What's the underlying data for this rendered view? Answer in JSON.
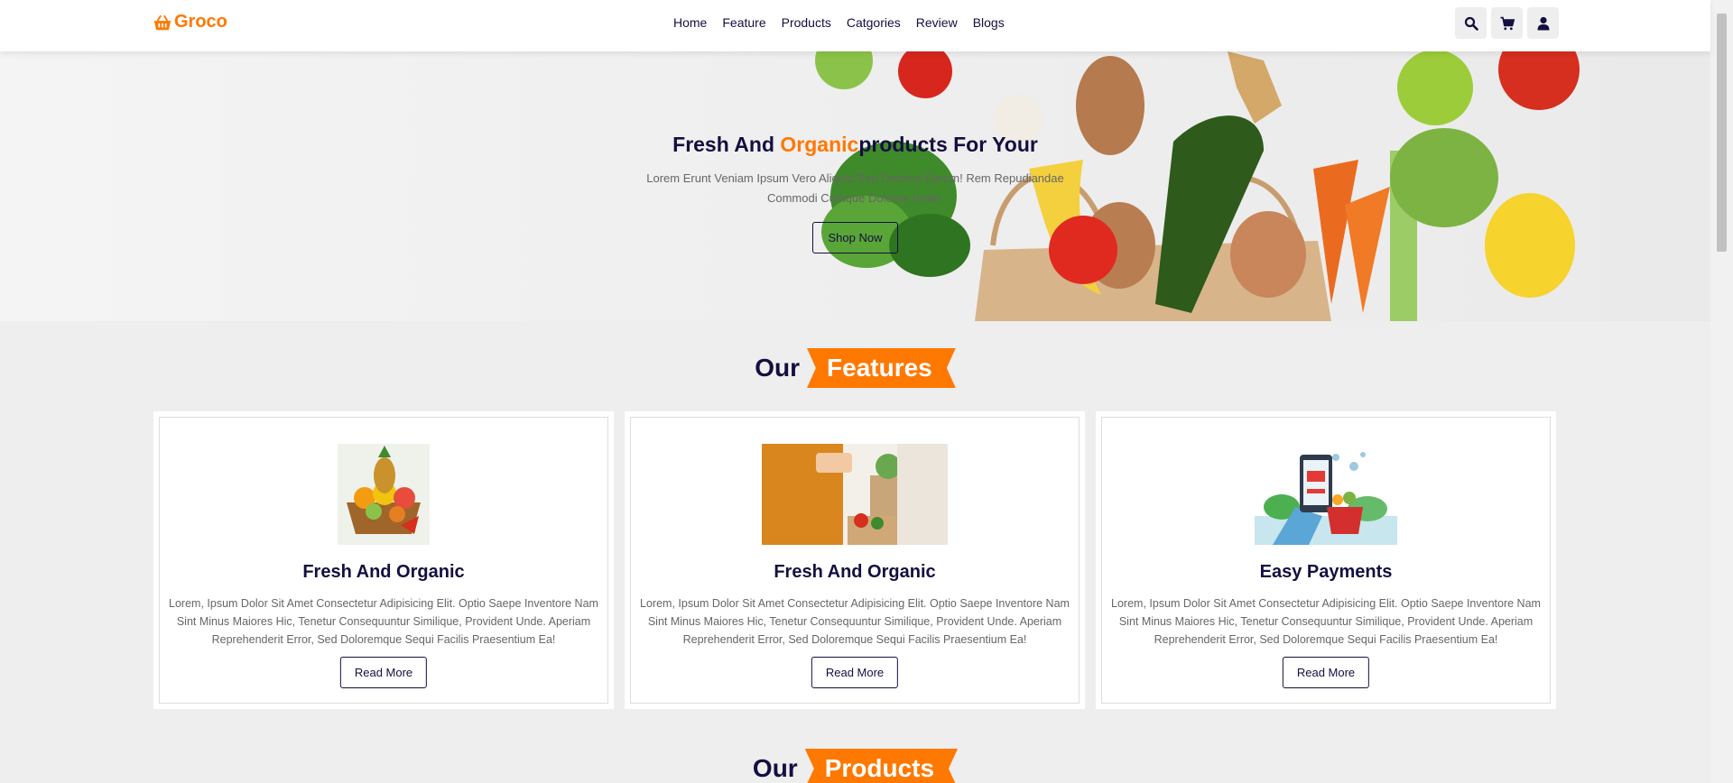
{
  "brand": {
    "name": "Groco",
    "accent": "#ff7800",
    "dark": "#130f40"
  },
  "nav": {
    "items": [
      "Home",
      "Feature",
      "Products",
      "Catgories",
      "Review",
      "Blogs"
    ]
  },
  "header_icons": [
    "search-icon",
    "cart-icon",
    "user-icon"
  ],
  "hero": {
    "title_part1": "Fresh And ",
    "title_accent": "Organic",
    "title_part2": "products For Your",
    "text": "Lorem Erunt Veniam Ipsum Vero Aliquid Sed Dolores Earum! Rem Repudiandae Commodi Cumque Dolores Unde.",
    "button": "Shop Now"
  },
  "features_heading": {
    "dark": "Our",
    "accent": "Features"
  },
  "features": [
    {
      "title": "Fresh And Organic",
      "text": "Lorem, Ipsum Dolor Sit Amet Consectetur Adipisicing Elit. Optio Saepe Inventore Nam Sint Minus Maiores Hic, Tenetur Consequuntur Similique, Provident Unde. Aperiam Reprehenderit Error, Sed Doloremque Sequi Facilis Praesentium Ea!",
      "button": "Read More"
    },
    {
      "title": "Fresh And Organic",
      "text": "Lorem, Ipsum Dolor Sit Amet Consectetur Adipisicing Elit. Optio Saepe Inventore Nam Sint Minus Maiores Hic, Tenetur Consequuntur Similique, Provident Unde. Aperiam Reprehenderit Error, Sed Doloremque Sequi Facilis Praesentium Ea!",
      "button": "Read More"
    },
    {
      "title": "Easy Payments",
      "text": "Lorem, Ipsum Dolor Sit Amet Consectetur Adipisicing Elit. Optio Saepe Inventore Nam Sint Minus Maiores Hic, Tenetur Consequuntur Similique, Provident Unde. Aperiam Reprehenderit Error, Sed Doloremque Sequi Facilis Praesentium Ea!",
      "button": "Read More"
    }
  ],
  "products_heading": {
    "dark": "Our",
    "accent": "Products"
  }
}
